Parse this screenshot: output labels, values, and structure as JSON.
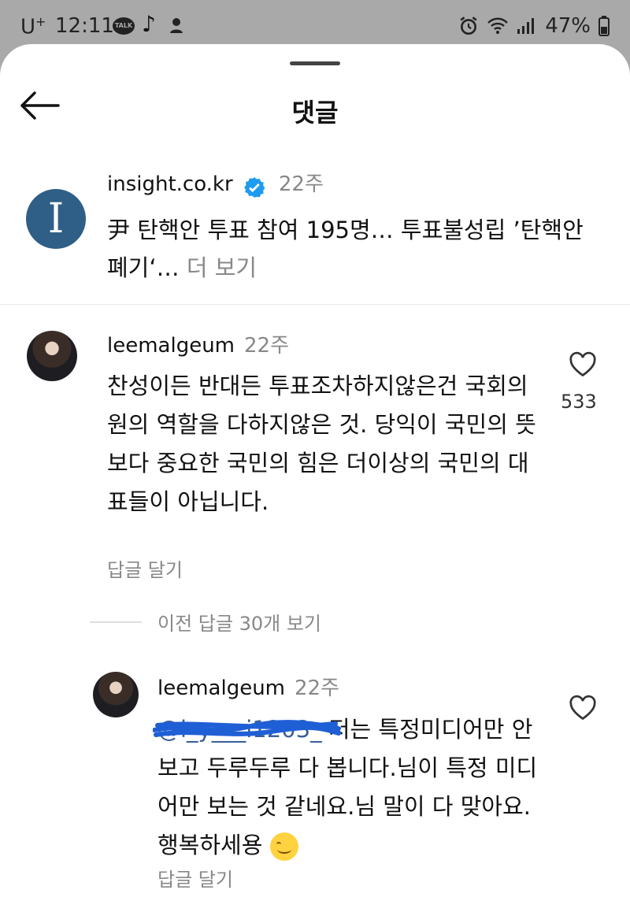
{
  "status_bar": {
    "carrier": "U",
    "carrier_sup": "+",
    "time": "12:11",
    "talk_icon_text": "TALK",
    "battery": "47%",
    "icons": [
      "kakaotalk-icon",
      "tiktok-icon",
      "notification-icon",
      "alarm-icon",
      "wifi-icon",
      "signal-icon",
      "battery-icon"
    ]
  },
  "header": {
    "title": "댓글",
    "back_icon": "arrow-left-icon"
  },
  "post": {
    "avatar_letter": "I",
    "username": "insight.co.kr",
    "verified": true,
    "ago": "22주",
    "text": "尹 탄핵안 투표 참여 195명… 투표불성립 ’탄핵안 폐기‘…",
    "more": "더 보기"
  },
  "comments": [
    {
      "username": "leemalgeum",
      "ago": "22주",
      "text": "찬성이든 반대든 투표조차하지않은건 국회의원의 역할을 다하지않은 것. 당익이 국민의 뜻보다 중요한 국민의 힘은 더이상의 국민의 대표들이 아닙니다.",
      "likes": "533",
      "reply_label": "답글 달기"
    }
  ],
  "view_previous": "이전 답글 30개 보기",
  "reply": {
    "username": "leemalgeum",
    "ago": "22주",
    "mention": "@l_y___i1203_",
    "text": "저는 특정미디어만 안보고 두루두루 다 봅니다.님이 특정 미디어만 보는 것 같네요.님 말이 다 맞아요.행복하세용",
    "emoji": "smiling-face-emoji",
    "reply_label": "답글 달기"
  },
  "colors": {
    "sheet_bg": "#ffffff",
    "status_bg": "#a9a9a9",
    "muted_text": "#888888",
    "verified_blue": "#1d9bf0",
    "post_avatar_bg": "#2f5f86",
    "mention_color": "#3a5f9b",
    "scribble_color": "#1f5fd6"
  }
}
